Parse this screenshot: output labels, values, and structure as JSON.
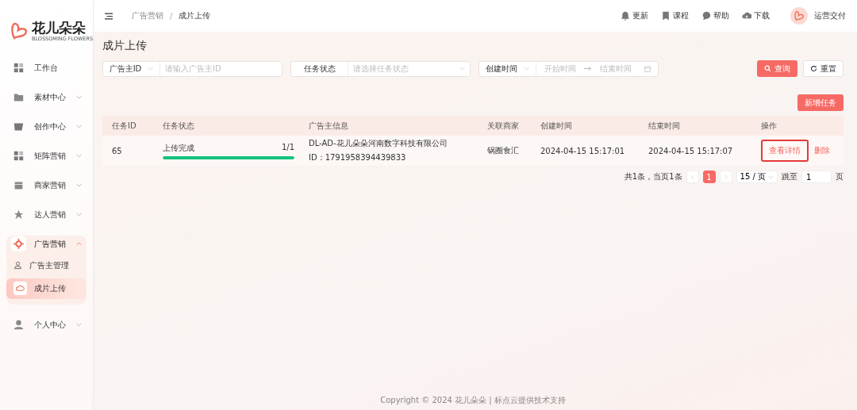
{
  "logo": {
    "name": "花儿朵朵",
    "tagline": "BLOSSOMING FLOWERS"
  },
  "sidebar": {
    "items": [
      {
        "label": "工作台",
        "kind": "link",
        "selected": false
      },
      {
        "label": "素材中心",
        "kind": "group",
        "expanded": false,
        "selected": false
      },
      {
        "label": "创作中心",
        "kind": "group",
        "expanded": false,
        "selected": false
      },
      {
        "label": "矩阵营销",
        "kind": "group",
        "expanded": false,
        "selected": false
      },
      {
        "label": "商家营销",
        "kind": "group",
        "expanded": false,
        "selected": false
      },
      {
        "label": "达人营销",
        "kind": "group",
        "expanded": false,
        "selected": false
      },
      {
        "label": "广告营销",
        "kind": "group",
        "expanded": true,
        "selected": true,
        "children": [
          {
            "label": "广告主管理",
            "selected": false
          },
          {
            "label": "成片上传",
            "selected": true
          }
        ]
      },
      {
        "label": "个人中心",
        "kind": "group",
        "expanded": false,
        "selected": false
      }
    ]
  },
  "breadcrumb": [
    "广告营销",
    "成片上传"
  ],
  "breadcrumb_separator": "/",
  "header_links": [
    "更新",
    "课程",
    "帮助",
    "下载"
  ],
  "user": {
    "name": "运营交付"
  },
  "page_title": "成片上传",
  "filters": [
    {
      "kind": "text",
      "label": "广告主ID",
      "placeholder": "请输入广告主ID"
    },
    {
      "kind": "select",
      "label": "任务状态",
      "placeholder": "请选择任务状态"
    },
    {
      "kind": "daterange",
      "label": "创建时间",
      "start_placeholder": "开始时间",
      "end_placeholder": "结束时间"
    }
  ],
  "buttons": {
    "search": "查询",
    "reset": "重置",
    "add": "新增任务"
  },
  "table": {
    "columns": [
      "任务ID",
      "任务状态",
      "广告主信息",
      "关联商家",
      "创建时间",
      "结束时间",
      "操作"
    ],
    "rows": [
      {
        "id": "65",
        "status": "上传完成",
        "progress_text": "1/1",
        "level": 1,
        "advertiser": "DL-AD-花儿朵朵河南数字科技有限公司",
        "advertiser_id": "ID：1791958394439833",
        "merchant": "锅圈食汇",
        "created": "2024-04-15 15:17:01",
        "ended": "2024-04-15 15:17:07",
        "actions": [
          "查看详情",
          "删除"
        ]
      }
    ]
  },
  "pagination": {
    "summary": "共1条，当页1条",
    "pages": [
      {
        "label": "1",
        "selected": true
      }
    ],
    "page_size": "15 / 页",
    "goto_label": "跳至",
    "goto_value": "1",
    "goto_suffix": "页"
  },
  "footer": "Copyright © 2024 花儿朵朵 | 标点云提供技术支持"
}
